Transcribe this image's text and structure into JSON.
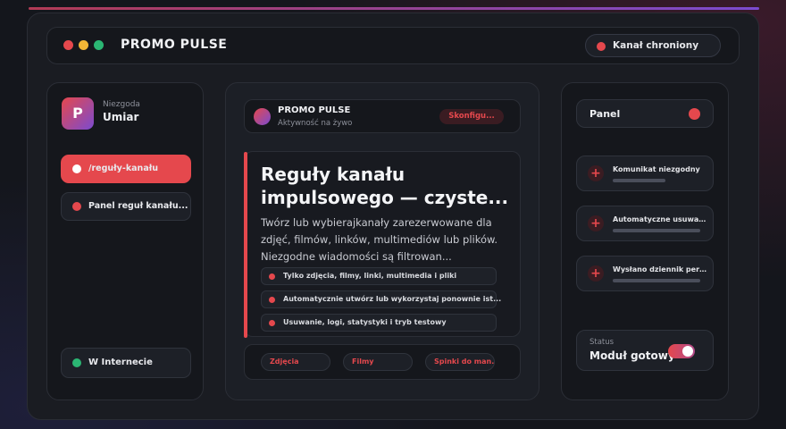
{
  "app": {
    "title": "PROMO PULSE",
    "channel_status": "Kanał chroniony"
  },
  "colors": {
    "accent": "#e5484d",
    "accent_secondary": "#7b4bd0",
    "online": "#2bb673",
    "window_dots": [
      "#e5484d",
      "#f2b636",
      "#2bb673"
    ]
  },
  "sidebar": {
    "avatar_letter": "P",
    "user_subtitle": "Niezgoda",
    "user_name": "Umiar",
    "items": [
      {
        "label": "/reguły-kanału",
        "active": true
      },
      {
        "label": "Panel reguł kanału..."
      }
    ],
    "status_label": "W Internecie"
  },
  "center": {
    "header": {
      "name": "PROMO PULSE",
      "subtitle": "Aktywność na żywo",
      "configure_label": "Skonfigu..."
    },
    "card": {
      "title": "Reguły kanału impulsowego — czyste...",
      "description": "Twórz lub wybierajkanały zarezerwowane dla zdjęć, filmów, linków, multimediów lub plików. Niezgodne wiadomości są filtrowan...",
      "features": [
        "Tylko zdjęcia, filmy, linki, multimedia i pliki",
        "Automatycznie utwórz lub wykorzystaj ponownie ist...",
        "Usuwanie, logi, statystyki i tryb testowy"
      ]
    },
    "chips": [
      "Zdjęcia",
      "Filmy",
      "Spinki do man..."
    ]
  },
  "right": {
    "panel_title": "Panel",
    "items": [
      {
        "label": "Komunikat niezgodny",
        "progress": 0.45
      },
      {
        "label": "Automatyczne usuwanie",
        "progress": 0.75
      },
      {
        "label": "Wysłano dziennik pers...",
        "progress": 0.75
      }
    ],
    "status_key": "Status",
    "status_value": "Moduł gotowy",
    "toggle_on": true
  }
}
